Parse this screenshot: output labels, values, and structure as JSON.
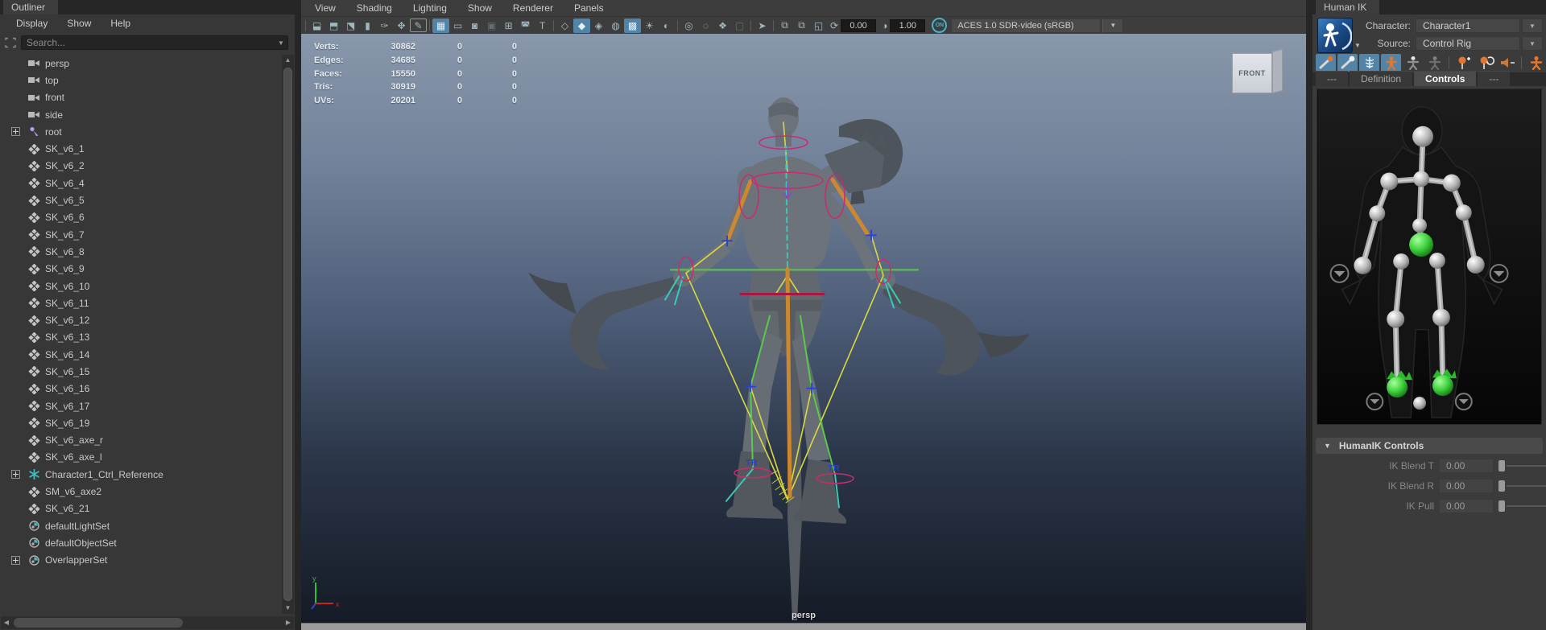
{
  "outliner": {
    "tab": "Outliner",
    "menus": [
      "Display",
      "Show",
      "Help"
    ],
    "search_placeholder": "Search...",
    "items": [
      {
        "label": "persp",
        "icon": "camera"
      },
      {
        "label": "top",
        "icon": "camera"
      },
      {
        "label": "front",
        "icon": "camera"
      },
      {
        "label": "side",
        "icon": "camera"
      },
      {
        "label": "root",
        "icon": "joint",
        "expand": true
      },
      {
        "label": "SK_v6_1",
        "icon": "mesh"
      },
      {
        "label": "SK_v6_2",
        "icon": "mesh"
      },
      {
        "label": "SK_v6_4",
        "icon": "mesh"
      },
      {
        "label": "SK_v6_5",
        "icon": "mesh"
      },
      {
        "label": "SK_v6_6",
        "icon": "mesh"
      },
      {
        "label": "SK_v6_7",
        "icon": "mesh"
      },
      {
        "label": "SK_v6_8",
        "icon": "mesh"
      },
      {
        "label": "SK_v6_9",
        "icon": "mesh"
      },
      {
        "label": "SK_v6_10",
        "icon": "mesh"
      },
      {
        "label": "SK_v6_11",
        "icon": "mesh"
      },
      {
        "label": "SK_v6_12",
        "icon": "mesh"
      },
      {
        "label": "SK_v6_13",
        "icon": "mesh"
      },
      {
        "label": "SK_v6_14",
        "icon": "mesh"
      },
      {
        "label": "SK_v6_15",
        "icon": "mesh"
      },
      {
        "label": "SK_v6_16",
        "icon": "mesh"
      },
      {
        "label": "SK_v6_17",
        "icon": "mesh"
      },
      {
        "label": "SK_v6_19",
        "icon": "mesh"
      },
      {
        "label": "SK_v6_axe_r",
        "icon": "mesh"
      },
      {
        "label": "SK_v6_axe_l",
        "icon": "mesh"
      },
      {
        "label": "Character1_Ctrl_Reference",
        "icon": "locator",
        "expand": true
      },
      {
        "label": "SM_v6_axe2",
        "icon": "mesh"
      },
      {
        "label": "SK_v6_21",
        "icon": "mesh"
      },
      {
        "label": "defaultLightSet",
        "icon": "set"
      },
      {
        "label": "defaultObjectSet",
        "icon": "set"
      },
      {
        "label": "OverlapperSet",
        "icon": "set",
        "expand": true
      }
    ]
  },
  "viewport": {
    "menus": [
      "View",
      "Shading",
      "Lighting",
      "Show",
      "Renderer",
      "Panels"
    ],
    "toolbar": {
      "icons": [
        {
          "name": "select-camera",
          "glyph": "⬓"
        },
        {
          "name": "lock-camera",
          "glyph": "⬒"
        },
        {
          "name": "camera-attributes",
          "glyph": "⬔"
        },
        {
          "name": "bookmark",
          "glyph": "▮"
        },
        {
          "name": "image-plane",
          "glyph": "✑"
        },
        {
          "name": "pan-zoom-2d",
          "glyph": "✥"
        },
        {
          "name": "grease-pencil",
          "glyph": "✎",
          "state": "greensel"
        },
        {
          "name": "sep"
        },
        {
          "name": "grid",
          "glyph": "▦",
          "state": "active"
        },
        {
          "name": "film-gate",
          "glyph": "▭"
        },
        {
          "name": "resolution-gate",
          "glyph": "◙"
        },
        {
          "name": "gate-mask",
          "glyph": "▣",
          "state": "dim"
        },
        {
          "name": "field-chart",
          "glyph": "⊞"
        },
        {
          "name": "safe-action",
          "glyph": "◚"
        },
        {
          "name": "safe-title",
          "glyph": "T"
        },
        {
          "name": "sep"
        },
        {
          "name": "wireframe",
          "glyph": "◇"
        },
        {
          "name": "smooth-shade-all",
          "glyph": "◆",
          "state": "active"
        },
        {
          "name": "wireframe-on-shaded",
          "glyph": "◈"
        },
        {
          "name": "textured",
          "glyph": "◍"
        },
        {
          "name": "use-default-material",
          "glyph": "▩",
          "state": "active"
        },
        {
          "name": "lighting",
          "glyph": "☀"
        },
        {
          "name": "shadows",
          "glyph": "◐"
        },
        {
          "name": "sep"
        },
        {
          "name": "screen-space-ao",
          "glyph": "◎"
        },
        {
          "name": "motion-blur",
          "glyph": "◌"
        },
        {
          "name": "multisample-aa",
          "glyph": "❖"
        },
        {
          "name": "depth-of-field",
          "glyph": "▢",
          "state": "dim"
        },
        {
          "name": "sep"
        },
        {
          "name": "isolate-select",
          "glyph": "➤"
        },
        {
          "name": "sep"
        },
        {
          "name": "tear-off",
          "glyph": "⧉"
        },
        {
          "name": "tear-off-copy",
          "glyph": "⧉"
        },
        {
          "name": "letterbox",
          "glyph": "◱"
        }
      ],
      "exposure_value": "0.00",
      "gamma_value": "1.00",
      "on_label": "ON",
      "colorspace": "ACES 1.0 SDR-video (sRGB)"
    },
    "hud": {
      "rows": [
        {
          "label": "Verts:",
          "value": "30862",
          "col2": "0",
          "col3": "0"
        },
        {
          "label": "Edges:",
          "value": "34685",
          "col2": "0",
          "col3": "0"
        },
        {
          "label": "Faces:",
          "value": "15550",
          "col2": "0",
          "col3": "0"
        },
        {
          "label": "Tris:",
          "value": "30919",
          "col2": "0",
          "col3": "0"
        },
        {
          "label": "UVs:",
          "value": "20201",
          "col2": "0",
          "col3": "0"
        }
      ]
    },
    "view_cube_label": "FRONT",
    "camera_label": "persp",
    "axis_y_label": "y",
    "axis_x_label": "x"
  },
  "humanik": {
    "tab": "Human IK",
    "character_label": "Character:",
    "character_value": "Character1",
    "source_label": "Source:",
    "source_value": "Control Rig",
    "toolbar_icons": [
      {
        "name": "key-bone-ik",
        "state": "active"
      },
      {
        "name": "key-bone-fk",
        "state": "active"
      },
      {
        "name": "skeleton-mode",
        "state": "active"
      },
      {
        "name": "full-body-mode",
        "state": "active"
      },
      {
        "name": "body-part-mode"
      },
      {
        "name": "selection-mode"
      },
      {
        "name": "sep"
      },
      {
        "name": "pin-translate"
      },
      {
        "name": "pin-rotate"
      },
      {
        "name": "mute"
      },
      {
        "name": "sep"
      },
      {
        "name": "stance-pose"
      }
    ],
    "tabs": [
      "---",
      "Definition",
      "Controls",
      "---"
    ],
    "active_tab_index": 2,
    "controls_section": {
      "title": "HumanIK Controls",
      "fields": [
        {
          "label": "IK Blend T",
          "value": "0.00"
        },
        {
          "label": "IK Blend R",
          "value": "0.00"
        },
        {
          "label": "IK Pull",
          "value": "0.00"
        }
      ]
    }
  },
  "colors": {
    "toolbar_active": "#5284a7",
    "rig_selected_green": "#3fd23f",
    "hik_orange": "#e0762f",
    "viewport_top": "#8897aa",
    "viewport_bottom": "#151b26"
  }
}
